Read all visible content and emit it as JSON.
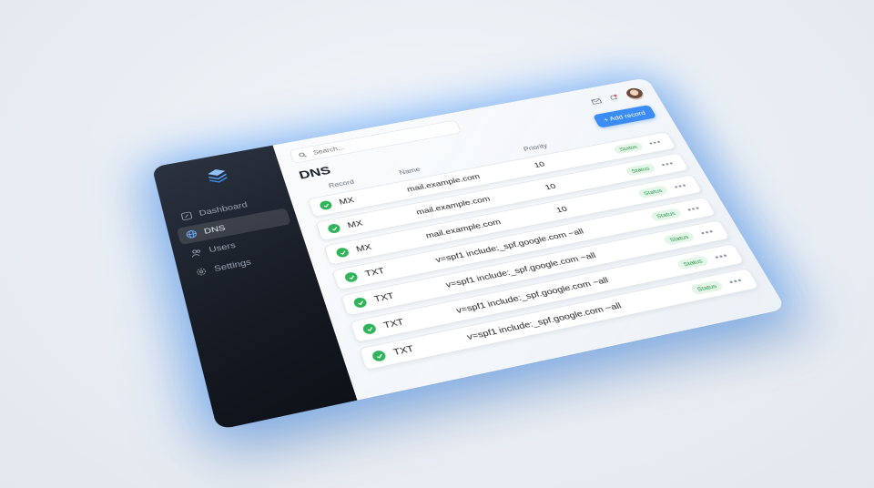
{
  "sidebar": {
    "items": [
      {
        "label": "Dashboard",
        "icon": "dashboard-icon",
        "active": false
      },
      {
        "label": "DNS",
        "icon": "globe-icon",
        "active": true
      },
      {
        "label": "Users",
        "icon": "users-icon",
        "active": false
      },
      {
        "label": "Settings",
        "icon": "gear-icon",
        "active": false
      }
    ]
  },
  "header": {
    "search_placeholder": "Search...",
    "title": "DNS",
    "add_button_label": "+ Add record"
  },
  "table": {
    "columns": [
      "Record",
      "Name",
      "Priority"
    ],
    "rows": [
      {
        "type": "MX",
        "name": "mail.example.com",
        "priority": "10",
        "status": "Status"
      },
      {
        "type": "MX",
        "name": "mail.example.com",
        "priority": "10",
        "status": "Status"
      },
      {
        "type": "MX",
        "name": "mail.example.com",
        "priority": "10",
        "status": "Status"
      },
      {
        "type": "TXT",
        "name": "v=spf1 include:_spf.google.com ~all",
        "priority": "",
        "status": "Status"
      },
      {
        "type": "TXT",
        "name": "v=spf1 include:_spf.google.com ~all",
        "priority": "",
        "status": "Status"
      },
      {
        "type": "TXT",
        "name": "v=spf1 include:_spf.google.com ~all",
        "priority": "",
        "status": "Status"
      },
      {
        "type": "TXT",
        "name": "v=spf1 include:_spf.google.com ~all",
        "priority": "",
        "status": "Status"
      }
    ]
  },
  "colors": {
    "accent": "#3b8df5",
    "success": "#2fb45a",
    "sidebar_bg": "#161b24",
    "glow": "#4096ff"
  }
}
